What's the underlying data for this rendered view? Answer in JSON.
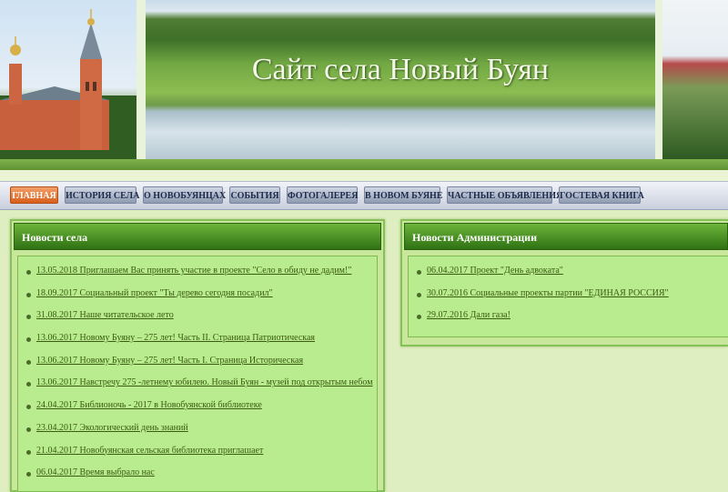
{
  "header": {
    "site_title": "Сайт села Новый Буян"
  },
  "nav": {
    "items": [
      {
        "label": "ГЛАВНАЯ",
        "active": true
      },
      {
        "label": "ИСТОРИЯ СЕЛА",
        "active": false
      },
      {
        "label": "О НОВОБУЯНЦАХ",
        "active": false
      },
      {
        "label": "СОБЫТИЯ",
        "active": false
      },
      {
        "label": "ФОТОГАЛЕРЕЯ",
        "active": false
      },
      {
        "label": "В НОВОМ БУЯНЕ",
        "active": false
      },
      {
        "label": "ЧАСТНЫЕ ОБЪЯВЛЕНИЯ",
        "active": false
      },
      {
        "label": "ГОСТЕВАЯ КНИГА",
        "active": false
      }
    ]
  },
  "village_news": {
    "title": "Новости села",
    "items": [
      "13.05.2018 Приглашаем Вас принять участие в проекте \"Село в обиду не дадим!\"",
      "18.09.2017 Социальный проект \"Ты дерево сегодня посадил\"",
      "31.08.2017 Наше читательское лето",
      "13.06.2017 Новому Буяну – 275 лет! Часть II. Страница Патриотическая",
      "13.06.2017 Новому Буяну – 275 лет! Часть I. Страница Историческая",
      "13.06.2017 Навстречу 275 -летнему юбилею. Новый Буян - музей под открытым небом",
      "24.04.2017 Библионочь - 2017 в Новобуянской библиотеке",
      "23.04.2017 Экологический день знаний",
      "21.04.2017 Новобуянская сельская библиотека приглашает",
      "06.04.2017 Время выбрало нас"
    ]
  },
  "admin_news": {
    "title": "Новости Администрации",
    "items": [
      "06.04.2017 Проект \"День адвоката\"",
      "30.07.2016 Социальные проекты партии \"ЕДИНАЯ РОССИЯ\"",
      "29.07.2016 Дали газа!"
    ]
  },
  "colors": {
    "accent_green": "#2f7114",
    "active_tab": "#d85f1c",
    "link": "#3b5a12"
  }
}
